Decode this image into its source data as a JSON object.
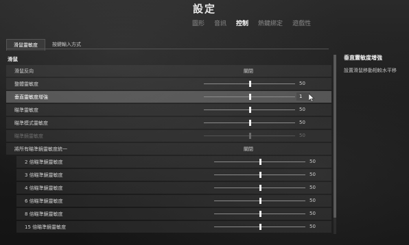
{
  "header": {
    "title": "設定",
    "tabs": [
      {
        "label": "圖形",
        "active": false
      },
      {
        "label": "音訊",
        "active": false
      },
      {
        "label": "控制",
        "active": true
      },
      {
        "label": "熱鍵綁定",
        "active": false
      },
      {
        "label": "遊戲性",
        "active": false
      }
    ]
  },
  "sub_tabs": [
    {
      "label": "滑鼠靈敏度",
      "active": true
    },
    {
      "label": "按鍵輸入方式",
      "active": false
    }
  ],
  "section": {
    "title": "滑鼠"
  },
  "rows": [
    {
      "label": "滑鼠反向",
      "type": "toggle",
      "value": "關閉"
    },
    {
      "label": "整體靈敏度",
      "type": "slider",
      "value": "50",
      "fraction": 0.5
    },
    {
      "label": "垂直靈敏度增強",
      "type": "slider-input",
      "value": "1",
      "fraction": 0.5,
      "highlight": true
    },
    {
      "label": "瞄準靈敏度",
      "type": "slider",
      "value": "50",
      "fraction": 0.5
    },
    {
      "label": "瞄準模式靈敏度",
      "type": "slider",
      "value": "50",
      "fraction": 0.5
    },
    {
      "label": "瞄準鏡靈敏度",
      "type": "slider",
      "value": "50",
      "fraction": 0.5,
      "disabled": true
    },
    {
      "label": "將所有瞄準鏡靈敏度統一",
      "type": "toggle",
      "value": "關閉"
    },
    {
      "label": "2 倍瞄準鏡靈敏度",
      "type": "slider",
      "value": "50",
      "fraction": 0.5,
      "indent": true
    },
    {
      "label": "3 倍瞄準鏡靈敏度",
      "type": "slider",
      "value": "50",
      "fraction": 0.5,
      "indent": true
    },
    {
      "label": "4 倍瞄準鏡靈敏度",
      "type": "slider",
      "value": "50",
      "fraction": 0.5,
      "indent": true
    },
    {
      "label": "6 倍瞄準鏡靈敏度",
      "type": "slider",
      "value": "50",
      "fraction": 0.5,
      "indent": true
    },
    {
      "label": "8 倍瞄準鏡靈敏度",
      "type": "slider",
      "value": "50",
      "fraction": 0.5,
      "indent": true
    },
    {
      "label": "15 倍瞄準鏡靈敏度",
      "type": "slider",
      "value": "50",
      "fraction": 0.5,
      "indent": true
    }
  ],
  "description": {
    "title": "垂直靈敏度增強",
    "text": "設置滑鼠移動相較水平移"
  },
  "icons": {
    "cursor": "mouse-cursor-icon"
  },
  "colors": {
    "background": "#1c1c1c",
    "highlight_row": "#5a5a5a",
    "active_tab": "#ffffff"
  }
}
